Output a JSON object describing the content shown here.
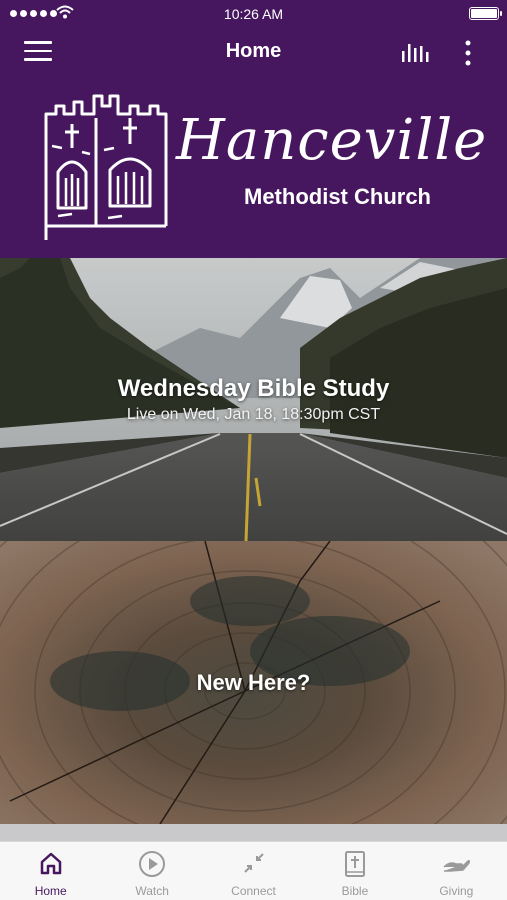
{
  "status_bar": {
    "time": "10:26 AM"
  },
  "nav": {
    "title": "Home"
  },
  "logo": {
    "line1": "Hanceville",
    "line2": "Methodist Church"
  },
  "cards": [
    {
      "title": "Wednesday Bible Study",
      "subtitle": "Live on Wed, Jan 18, 18:30pm CST"
    },
    {
      "title": "New Here?"
    }
  ],
  "tabs": [
    {
      "label": "Home",
      "icon": "home-icon",
      "active": true
    },
    {
      "label": "Watch",
      "icon": "play-icon",
      "active": false
    },
    {
      "label": "Connect",
      "icon": "connect-icon",
      "active": false
    },
    {
      "label": "Bible",
      "icon": "bible-icon",
      "active": false
    },
    {
      "label": "Giving",
      "icon": "giving-icon",
      "active": false
    }
  ],
  "colors": {
    "brand": "#46175f",
    "tab_inactive": "#9a9a9a"
  }
}
